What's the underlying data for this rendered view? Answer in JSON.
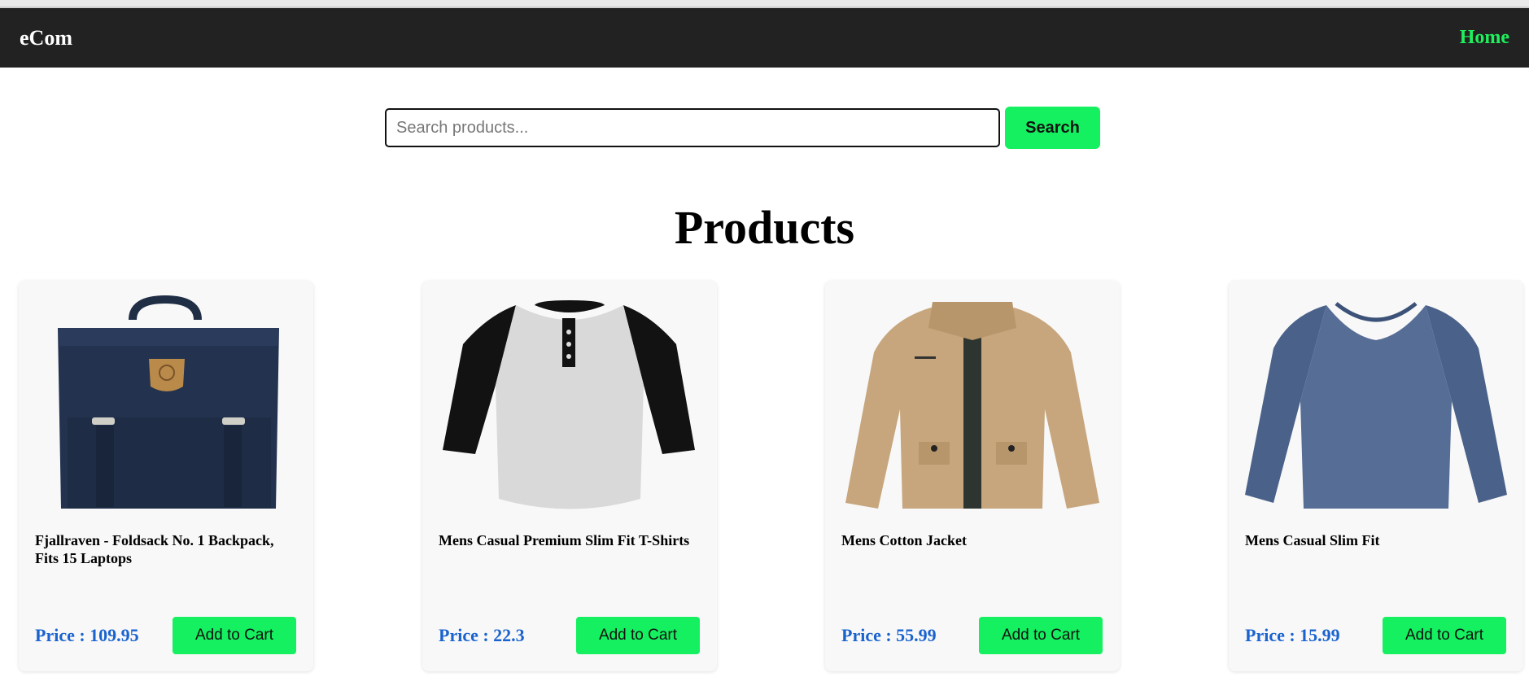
{
  "navbar": {
    "brand": "eCom",
    "home_link": "Home"
  },
  "search": {
    "placeholder": "Search products...",
    "value": "",
    "button_label": "Search"
  },
  "page_title": "Products",
  "products": [
    {
      "title": "Fjallraven - Foldsack No. 1 Backpack, Fits 15 Laptops",
      "price_label": "Price : 109.95",
      "add_label": "Add to Cart",
      "icon": "backpack-image"
    },
    {
      "title": "Mens Casual Premium Slim Fit T-Shirts",
      "price_label": "Price : 22.3",
      "add_label": "Add to Cart",
      "icon": "tshirt-image"
    },
    {
      "title": "Mens Cotton Jacket",
      "price_label": "Price : 55.99",
      "add_label": "Add to Cart",
      "icon": "jacket-image"
    },
    {
      "title": "Mens Casual Slim Fit",
      "price_label": "Price : 15.99",
      "add_label": "Add to Cart",
      "icon": "longsleeve-image"
    }
  ],
  "colors": {
    "navbar_bg": "#222222",
    "accent_green": "#14f05f",
    "home_link": "#1ff05c",
    "price_blue": "#1a63cf"
  }
}
